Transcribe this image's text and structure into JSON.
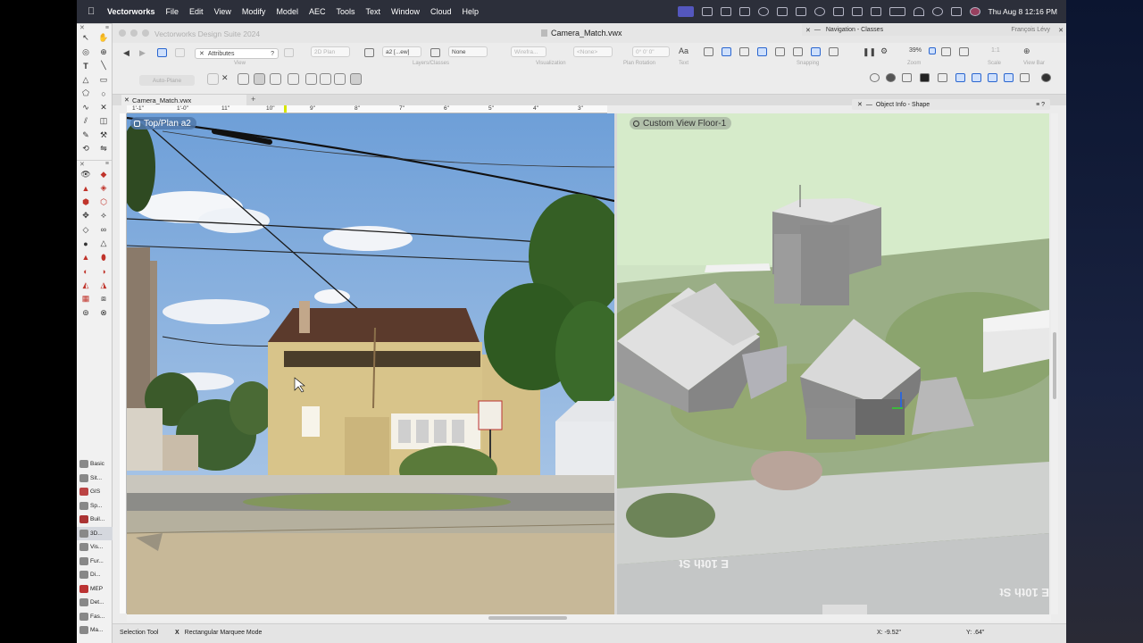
{
  "menubar": {
    "app": "Vectorworks",
    "items": [
      "File",
      "Edit",
      "View",
      "Modify",
      "Model",
      "AEC",
      "Tools",
      "Text",
      "Window",
      "Cloud",
      "Help"
    ],
    "clock": "Thu Aug 8  12:16 PM"
  },
  "window": {
    "suite_title": "Vectorworks Design Suite 2024",
    "document_title": "Camera_Match.vwx"
  },
  "nav_panel": {
    "title": "Navigation - Classes",
    "user": "François Lévy"
  },
  "toolbar": {
    "attributes_label": "Attributes",
    "help_label": "?",
    "plan_dropdown": "2D Plan",
    "layer_dropdown": "a2 [...ew]",
    "class_dropdown": "None",
    "render_dropdown": "Wirefra...",
    "none_dropdown": "<None>",
    "rotation_value": "0° 0' 0\"",
    "text_aa": "Aa",
    "zoom_value": "39%",
    "zoom_scale": "1:1",
    "group_view": "View",
    "group_layers": "Layers/Classes",
    "group_visualization": "Visualization",
    "group_plan_rotation": "Plan Rotation",
    "group_text": "Text",
    "group_snapping": "Snapping",
    "group_zoom": "Zoom",
    "group_scale": "Scale",
    "group_view_bar": "View Bar",
    "auto_plane": "Auto-Plane"
  },
  "doc_tab": {
    "label": "Camera_Match.vwx"
  },
  "ruler": {
    "labels": [
      "1'-1\"",
      "1'-0\"",
      "11\"",
      "10\"",
      "9\"",
      "8\"",
      "7\"",
      "6\"",
      "5\"",
      "4\"",
      "3\""
    ]
  },
  "viewports": {
    "left_label": "Top/Plan  a2",
    "right_label": "Custom View  Floor-1"
  },
  "scene_text": {
    "street_left": "E 10th St",
    "street_right": "E 10th St"
  },
  "object_info": {
    "title": "Object Info - Shape"
  },
  "tool_sets": [
    {
      "label": "Basic"
    },
    {
      "label": "Sit..."
    },
    {
      "label": "GIS"
    },
    {
      "label": "Sp..."
    },
    {
      "label": "Buil..."
    },
    {
      "label": "3D..."
    },
    {
      "label": "Vis..."
    },
    {
      "label": "Fur..."
    },
    {
      "label": "Di..."
    },
    {
      "label": "MEP"
    },
    {
      "label": "Det..."
    },
    {
      "label": "Fas..."
    },
    {
      "label": "Ma..."
    }
  ],
  "status": {
    "tool": "Selection Tool",
    "mode_x": "X",
    "mode": "Rectangular Marquee Mode",
    "coord_x": "X: -9.52\"",
    "coord_y": "Y: .64\""
  },
  "colors": {
    "menubar_bg": "#2c2f3a",
    "accent_blue": "#2a66d0",
    "tool_red": "#c0342b"
  }
}
